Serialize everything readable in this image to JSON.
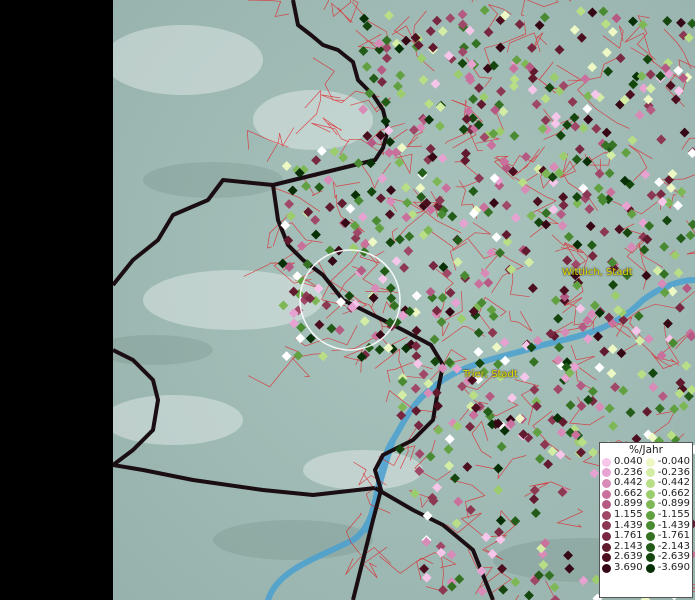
{
  "map": {
    "places": [
      {
        "name": "Wittlich, Stadt"
      },
      {
        "name": "Trier, Stadt"
      }
    ]
  },
  "legend": {
    "title": "%/Jahr",
    "positive": [
      {
        "label": "0.040",
        "color": "#f6c6ea"
      },
      {
        "label": "0.236",
        "color": "#e6a2d0"
      },
      {
        "label": "0.442",
        "color": "#d98bb8"
      },
      {
        "label": "0.662",
        "color": "#c9719c"
      },
      {
        "label": "0.899",
        "color": "#b55a82"
      },
      {
        "label": "1.155",
        "color": "#a04868"
      },
      {
        "label": "1.439",
        "color": "#8c3852"
      },
      {
        "label": "1.761",
        "color": "#782840"
      },
      {
        "label": "2.143",
        "color": "#621a2e"
      },
      {
        "label": "2.639",
        "color": "#4c0f20"
      },
      {
        "label": "3.690",
        "color": "#360714"
      }
    ],
    "negative": [
      {
        "label": "-0.040",
        "color": "#eef8c4"
      },
      {
        "label": "-0.236",
        "color": "#d4eda4"
      },
      {
        "label": "-0.442",
        "color": "#b8de86"
      },
      {
        "label": "-0.662",
        "color": "#9ccd6c"
      },
      {
        "label": "-0.899",
        "color": "#7eb856"
      },
      {
        "label": "-1.155",
        "color": "#62a142"
      },
      {
        "label": "-1.439",
        "color": "#4a8a32"
      },
      {
        "label": "-1.761",
        "color": "#357224"
      },
      {
        "label": "-2.143",
        "color": "#235c18"
      },
      {
        "label": "-2.639",
        "color": "#14460e"
      },
      {
        "label": "-3.690",
        "color": "#083006"
      }
    ]
  }
}
